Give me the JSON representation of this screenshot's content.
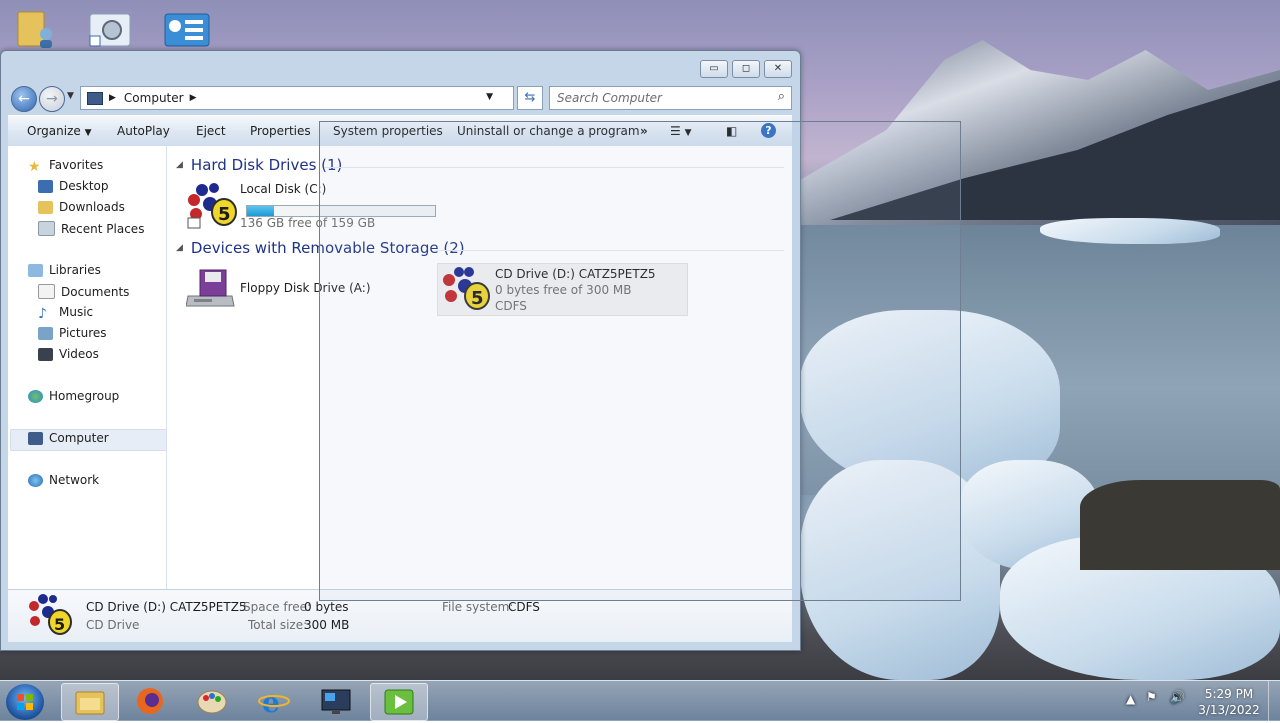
{
  "window": {
    "caption_buttons": [
      "minimize-icon",
      "maximize-icon",
      "close-icon"
    ],
    "address": "Computer",
    "search_placeholder": "Search Computer"
  },
  "toolbar": {
    "organize": "Organize",
    "autoplay": "AutoPlay",
    "eject": "Eject",
    "properties": "Properties",
    "system_properties": "System properties",
    "uninstall": "Uninstall or change a program",
    "more": "»"
  },
  "nav": {
    "favorites": "Favorites",
    "desktop": "Desktop",
    "downloads": "Downloads",
    "recent_places": "Recent Places",
    "libraries": "Libraries",
    "documents": "Documents",
    "music": "Music",
    "pictures": "Pictures",
    "videos": "Videos",
    "homegroup": "Homegroup",
    "computer": "Computer",
    "network": "Network"
  },
  "content": {
    "hdd_group": "Hard Disk Drives (1)",
    "removable_group": "Devices with Removable Storage (2)",
    "local_disk": {
      "name": "Local Disk (C:)",
      "free_text": "136 GB free of 159 GB",
      "used_fraction": 0.145
    },
    "floppy": {
      "name": "Floppy Disk Drive (A:)"
    },
    "cd": {
      "name": "CD Drive (D:) CATZ5PETZ5",
      "free_text": "0 bytes free of 300 MB",
      "fs": "CDFS"
    }
  },
  "details": {
    "name": "CD Drive (D:) CATZ5PETZ5",
    "type": "CD Drive",
    "space_free_label": "Space free:",
    "space_free": "0 bytes",
    "total_size_label": "Total size:",
    "total_size": "300 MB",
    "fs_label": "File system:",
    "fs": "CDFS"
  },
  "taskbar": {
    "time": "5:29 PM",
    "date": "3/13/2022",
    "apps": [
      "windows-explorer-icon",
      "firefox-icon",
      "paint-icon",
      "internet-explorer-icon",
      "remote-desktop-icon",
      "media-player-icon"
    ]
  }
}
